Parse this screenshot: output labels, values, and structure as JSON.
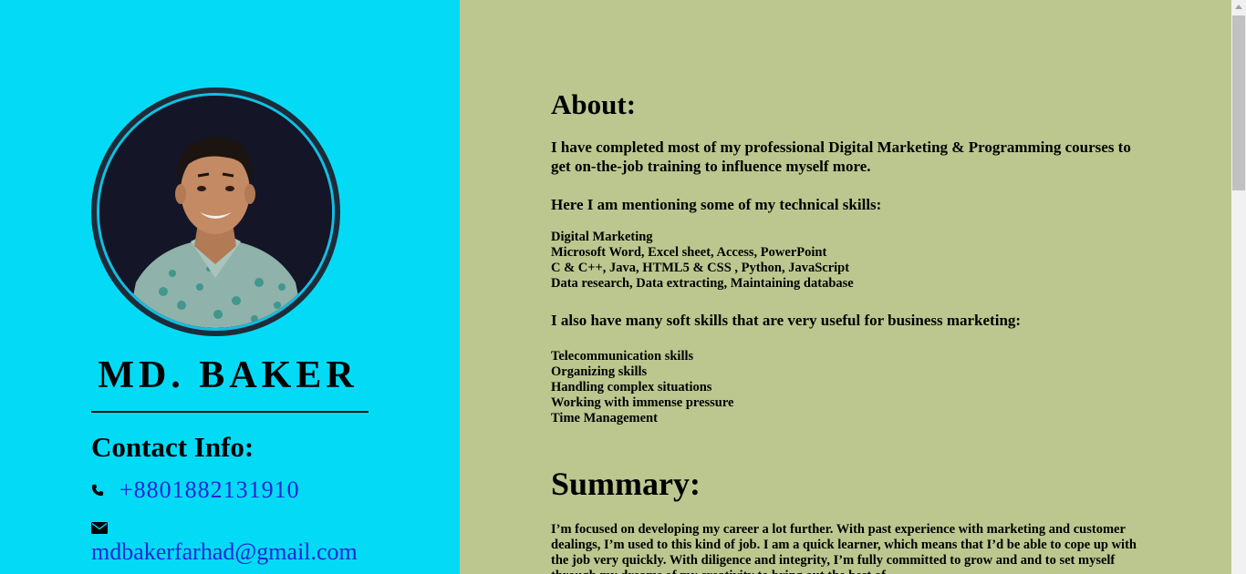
{
  "profile": {
    "name": "MD. BAKER",
    "contact_title": "Contact Info:",
    "phone": "+8801882131910",
    "email": "mdbakerfarhad@gmail.com"
  },
  "about": {
    "title": "About:",
    "intro": "I have completed most of my professional Digital Marketing & Programming courses to get on-the-job training to influence myself more.",
    "technical_heading": "Here I am mentioning some of my technical skills:",
    "technical_skills": [
      "Digital Marketing",
      "Microsoft Word, Excel sheet, Access, PowerPoint",
      "C & C++, Java, HTML5 & CSS , Python, JavaScript",
      "Data research, Data extracting, Maintaining database"
    ],
    "soft_heading": "I also have many soft skills that are very useful for business marketing:",
    "soft_skills": [
      "Telecommunication skills",
      "Organizing skills",
      "Handling complex situations",
      "Working with immense pressure",
      "Time Management"
    ]
  },
  "summary": {
    "title": "Summary:",
    "text": "I’m focused on developing my career a lot further. With past experience with marketing and customer dealings, I’m used to this kind of job. I am a quick learner, which means that I’d be able to cope up with the job very quickly. With diligence and integrity, I’m fully committed to grow and and to set myself through my dreams of my creativity to bring out the best of"
  },
  "colors": {
    "left_panel": "#03dbf6",
    "right_panel": "#bcc78f",
    "link": "#2424d6"
  },
  "icons": {
    "phone": "phone-icon",
    "email": "envelope-icon"
  }
}
